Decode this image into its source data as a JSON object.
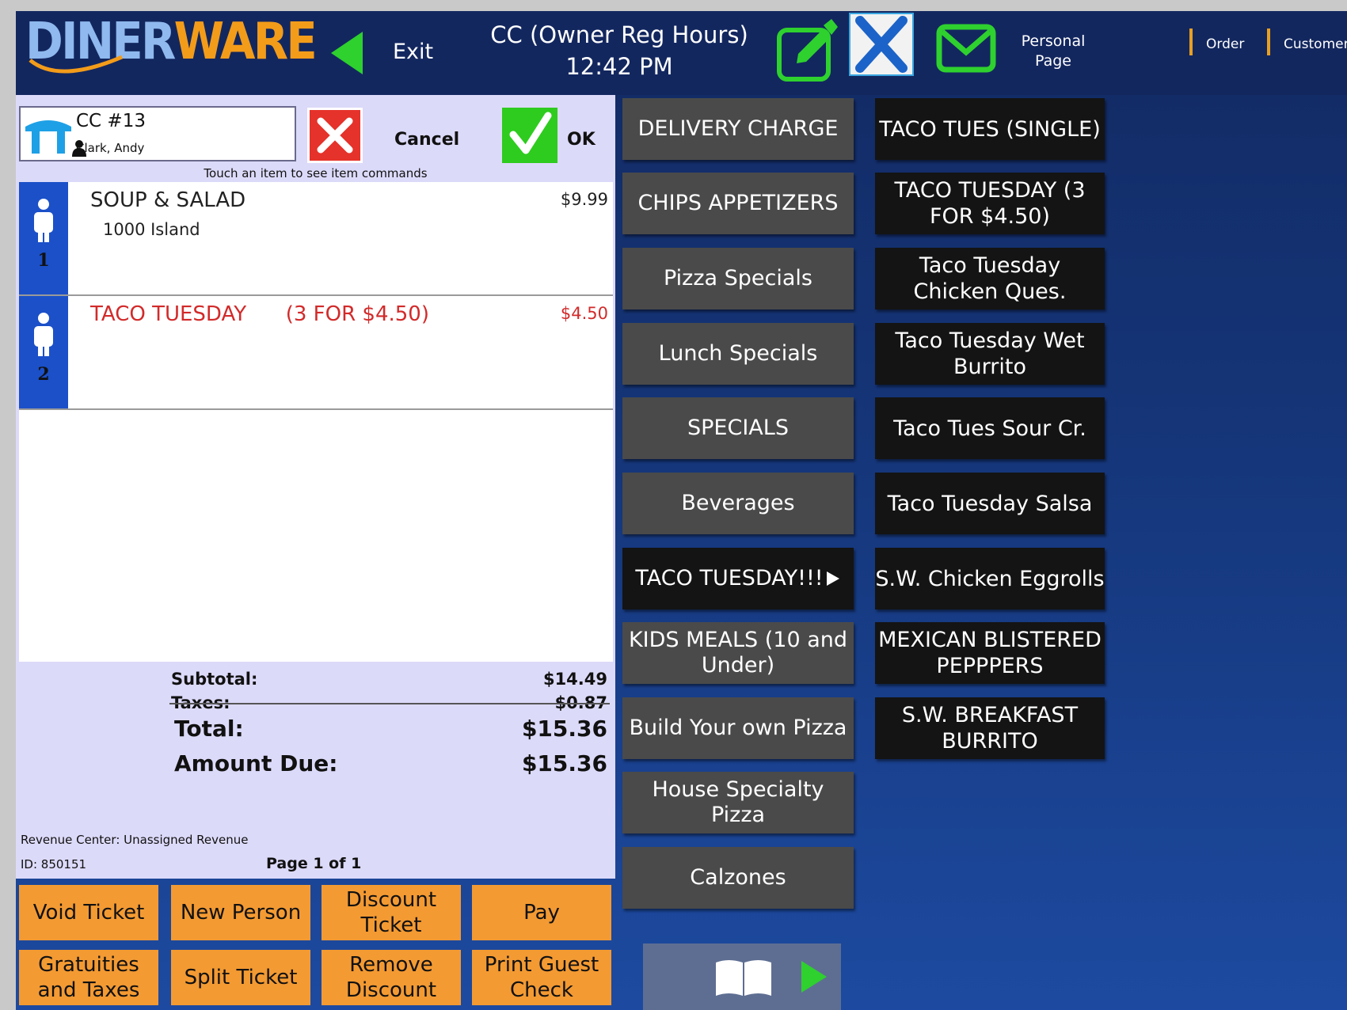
{
  "header": {
    "logo": "DINERWARE",
    "exit_label": "Exit",
    "title": "CC (Owner Reg Hours)",
    "time": "12:42 PM",
    "personal_page": "Personal Page",
    "tabs": [
      "Order",
      "Customer"
    ]
  },
  "ticket": {
    "name": "CC #13",
    "person": "Clark, Andy",
    "cancel_label": "Cancel",
    "ok_label": "OK",
    "hint": "Touch an item to see item commands",
    "seats": [
      {
        "number": "1",
        "item": "SOUP & SALAD",
        "modifier": "1000 Island",
        "price": "$9.99",
        "highlight": false
      },
      {
        "number": "2",
        "item": "TACO TUESDAY      (3 FOR $4.50)",
        "modifier": "",
        "price": "$4.50",
        "highlight": true
      }
    ],
    "totals": {
      "subtotal_label": "Subtotal:",
      "subtotal": "$14.49",
      "taxes_label": "Taxes:",
      "taxes": "$0.87",
      "total_label": "Total:",
      "total": "$15.36",
      "amount_due_label": "Amount Due:",
      "amount_due": "$15.36"
    },
    "revenue_center": "Revenue Center: Unassigned Revenue",
    "id": "ID: 850151",
    "page": "Page 1 of 1"
  },
  "actions": [
    "Void Ticket",
    "New Person",
    "Discount Ticket",
    "Pay",
    "Gratuities and Taxes",
    "Split Ticket",
    "Remove Discount",
    "Print Guest Check"
  ],
  "categories": [
    "DELIVERY CHARGE",
    "CHIPS APPETIZERS",
    "Pizza Specials",
    "Lunch Specials",
    "SPECIALS",
    "Beverages",
    "TACO TUESDAY!!!",
    "KIDS MEALS (10 and Under)",
    "Build Your own Pizza",
    "House Specialty Pizza",
    "Calzones"
  ],
  "active_category": "TACO TUESDAY!!!",
  "menu_items": [
    "TACO TUES (SINGLE)",
    "TACO TUESDAY (3 FOR $4.50)",
    "Taco Tuesday Chicken Ques.",
    "Taco Tuesday Wet Burrito",
    "Taco Tues Sour Cr.",
    "Taco Tuesday Salsa",
    "S.W. Chicken Eggrolls",
    "MEXICAN BLISTERED PEPPPERS",
    "S.W. BREAKFAST BURRITO"
  ],
  "colors": {
    "accent_orange": "#f39a33",
    "seat_blue": "#1b50c8",
    "ticket_bg": "#dcdaf9",
    "ok_green": "#2ecc1e",
    "cancel_red": "#e5322a"
  },
  "icons": [
    "back-arrow-icon",
    "edit-icon",
    "close-icon",
    "mail-icon",
    "table-icon",
    "person-icon",
    "book-icon",
    "play-icon"
  ]
}
